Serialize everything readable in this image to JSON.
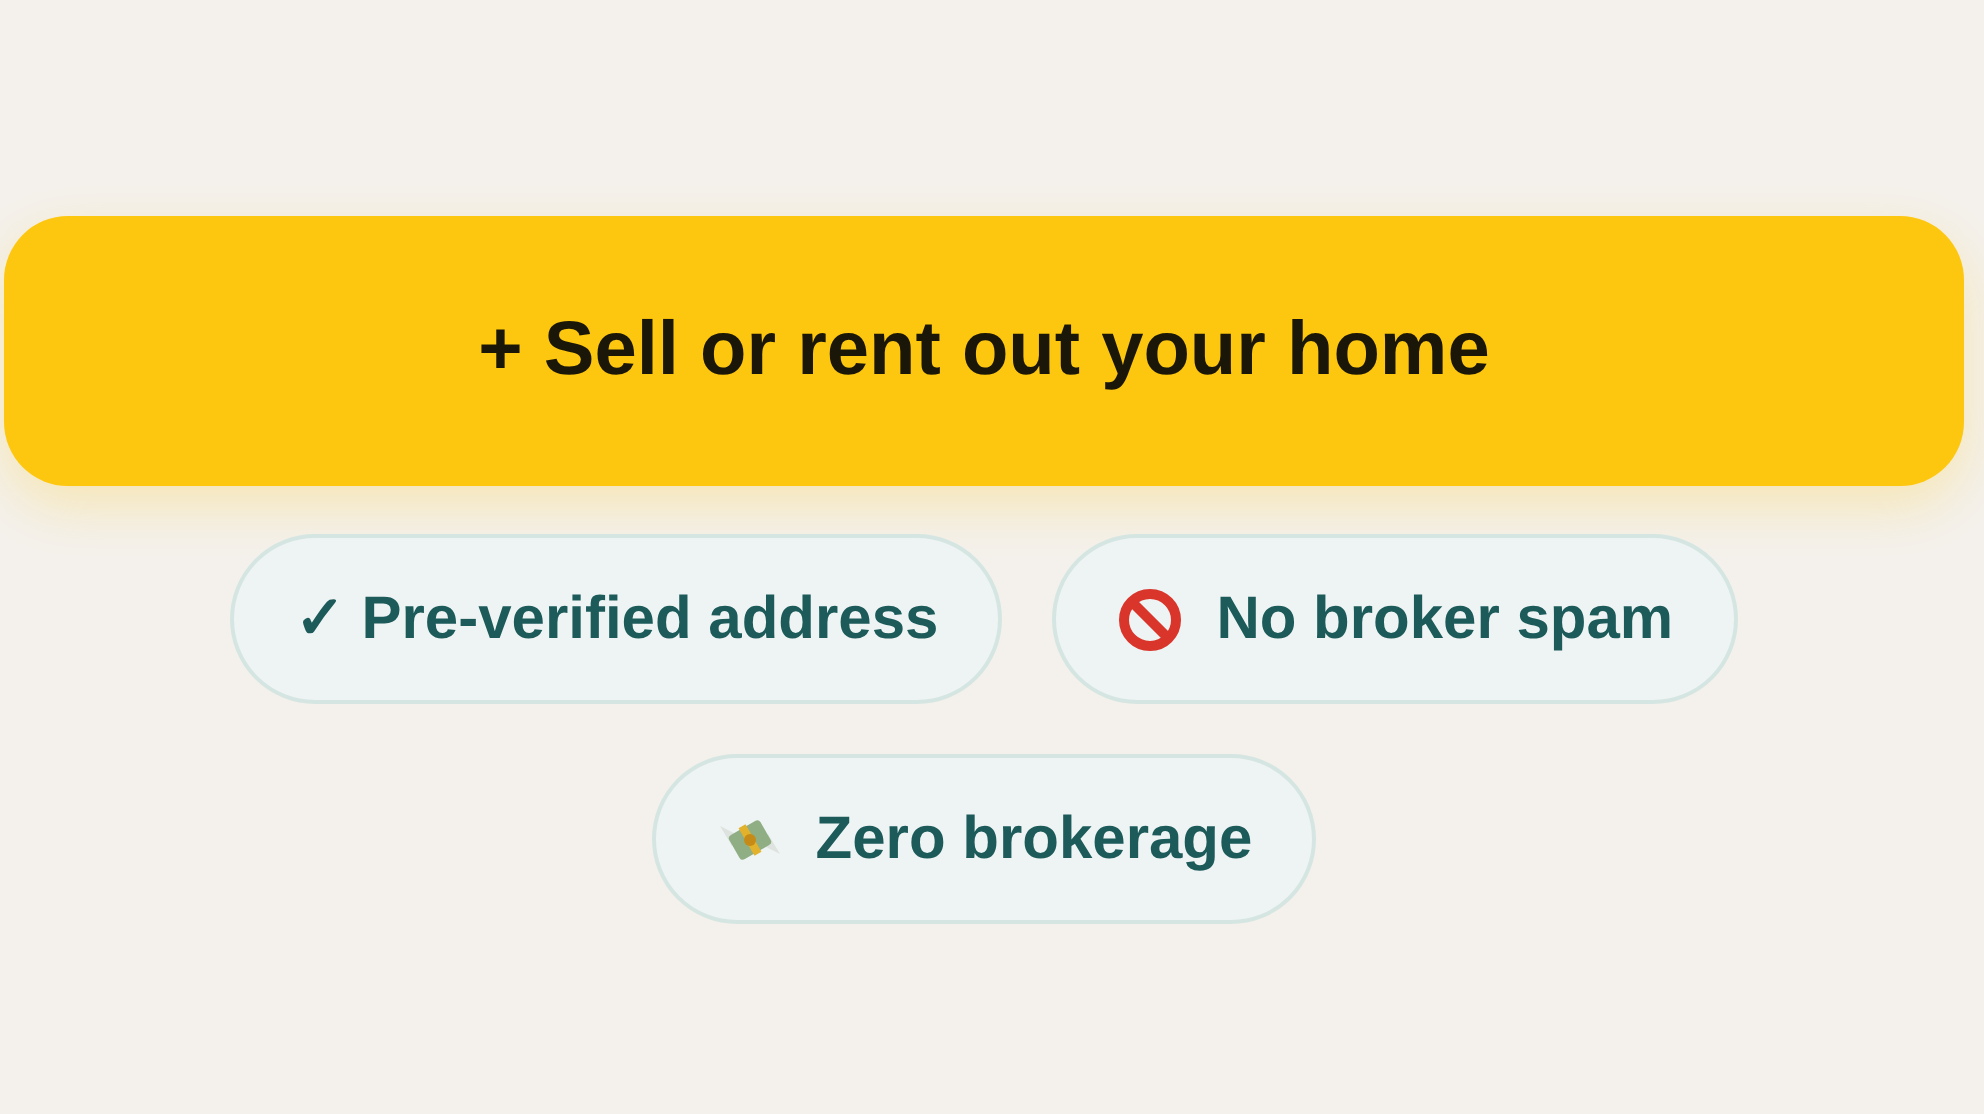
{
  "cta_button": {
    "label": "+ Sell or rent out your home"
  },
  "features": [
    {
      "kind": "text",
      "label": "✓ Pre-verified address"
    },
    {
      "kind": "no-entry",
      "label": "No broker spam"
    },
    {
      "kind": "money",
      "label": "Zero brokerage"
    }
  ]
}
